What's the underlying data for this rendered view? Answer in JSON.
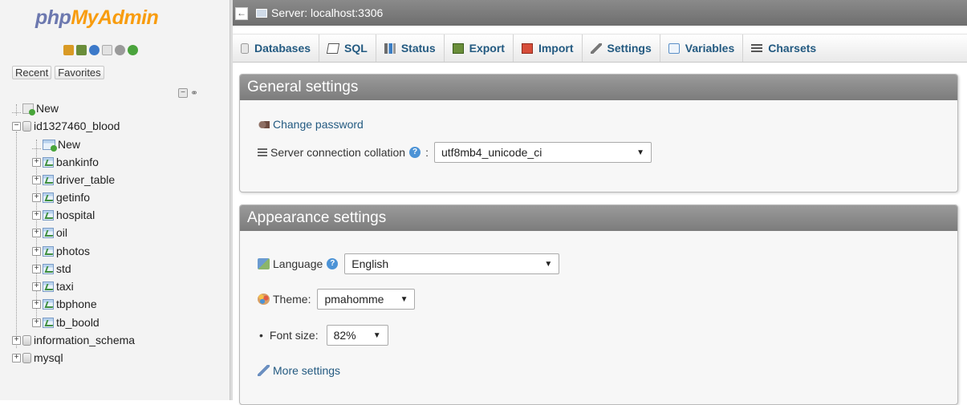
{
  "nav": {
    "logo_part1": "php",
    "logo_part2": "MyAdmin",
    "tabs": [
      "Recent",
      "Favorites"
    ],
    "tree": [
      {
        "label": "New",
        "kind": "new",
        "level": 0
      },
      {
        "label": "id1327460_blood",
        "kind": "db-open",
        "level": 0
      },
      {
        "label": "New",
        "kind": "new-table",
        "level": 1
      },
      {
        "label": "bankinfo",
        "kind": "table",
        "level": 1
      },
      {
        "label": "driver_table",
        "kind": "table",
        "level": 1
      },
      {
        "label": "getinfo",
        "kind": "table",
        "level": 1
      },
      {
        "label": "hospital",
        "kind": "table",
        "level": 1
      },
      {
        "label": "oil",
        "kind": "table",
        "level": 1
      },
      {
        "label": "photos",
        "kind": "table",
        "level": 1
      },
      {
        "label": "std",
        "kind": "table",
        "level": 1
      },
      {
        "label": "taxi",
        "kind": "table",
        "level": 1
      },
      {
        "label": "tbphone",
        "kind": "table",
        "level": 1
      },
      {
        "label": "tb_boold",
        "kind": "table",
        "level": 1
      },
      {
        "label": "information_schema",
        "kind": "db",
        "level": 0
      },
      {
        "label": "mysql",
        "kind": "db",
        "level": 0
      }
    ]
  },
  "topbar": {
    "breadcrumb": "Server: localhost:3306"
  },
  "tabs": [
    {
      "label": "Databases",
      "icon": "database-icon"
    },
    {
      "label": "SQL",
      "icon": "sql-icon"
    },
    {
      "label": "Status",
      "icon": "status-icon"
    },
    {
      "label": "Export",
      "icon": "export-icon"
    },
    {
      "label": "Import",
      "icon": "import-icon"
    },
    {
      "label": "Settings",
      "icon": "settings-icon"
    },
    {
      "label": "Variables",
      "icon": "variables-icon"
    },
    {
      "label": "Charsets",
      "icon": "charsets-icon"
    }
  ],
  "general": {
    "title": "General settings",
    "change_password": "Change password",
    "collation_label": "Server connection collation",
    "collation_colon": ":",
    "collation_value": "utf8mb4_unicode_ci"
  },
  "appearance": {
    "title": "Appearance settings",
    "language_label": "Language",
    "language_value": "English",
    "theme_label": "Theme:",
    "theme_value": "pmahomme",
    "font_label": "Font size:",
    "font_value": "82%",
    "more_settings": "More settings"
  },
  "colors": {
    "link": "#235a81",
    "panel_header": "#8a8a8a",
    "logo_php": "#6c78af",
    "logo_myadmin": "#f89c0e"
  }
}
